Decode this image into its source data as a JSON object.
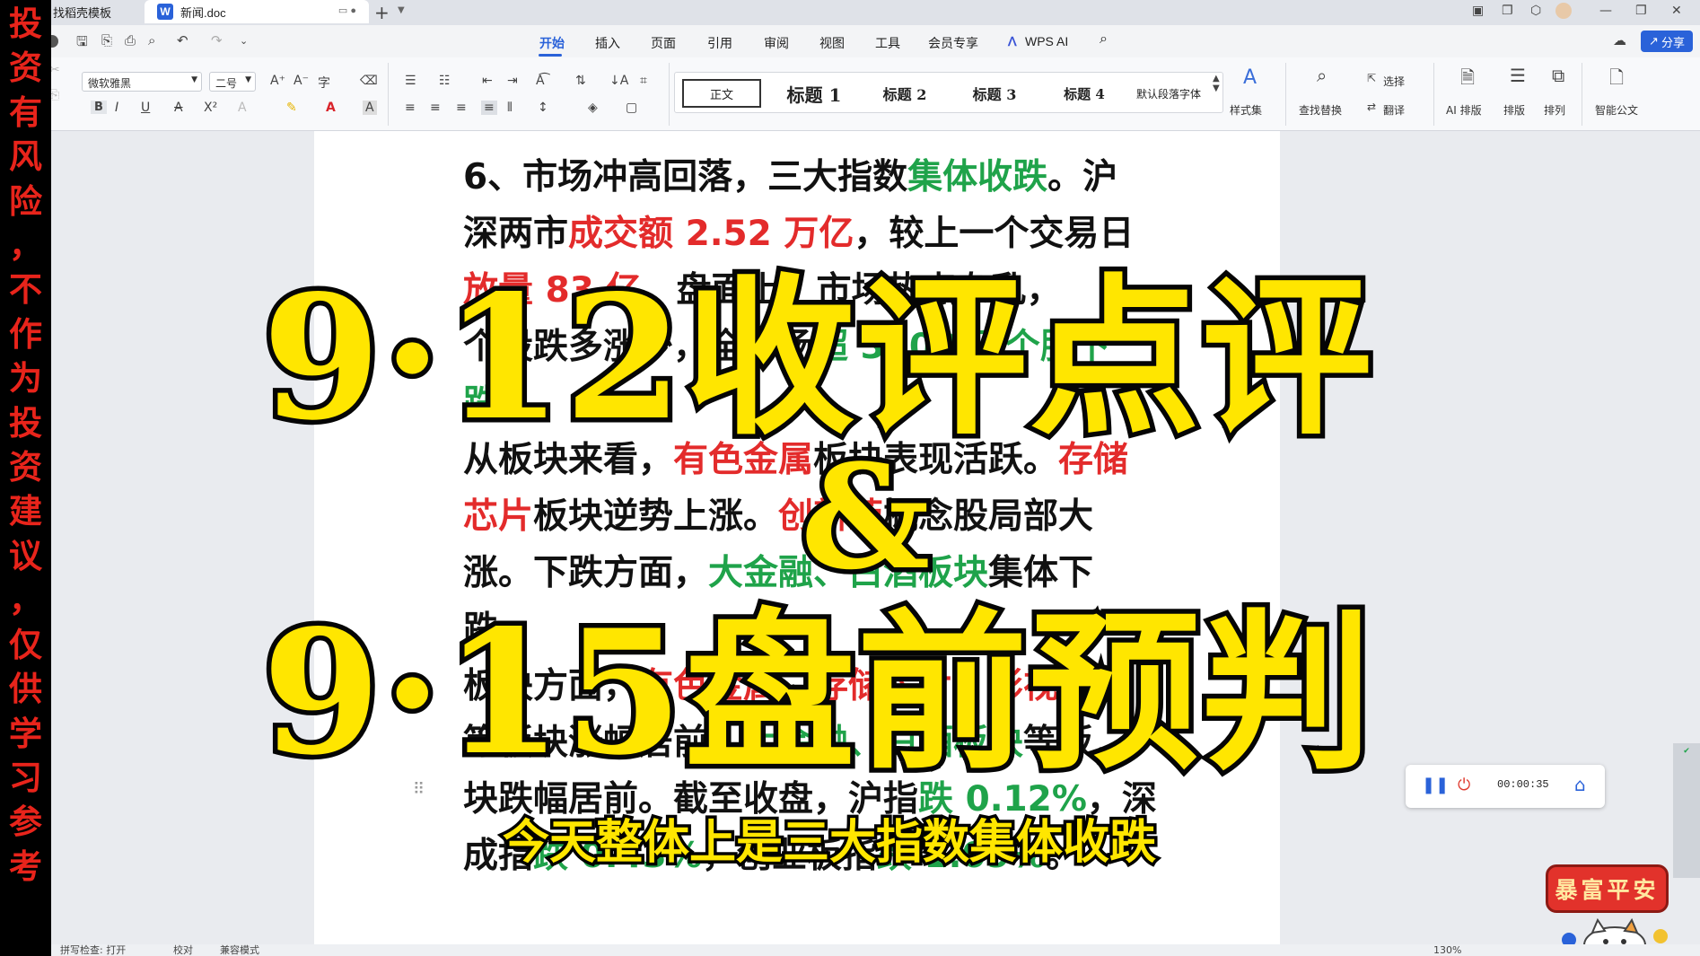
{
  "warning_text": "投资有风险，不作为投资建议，仅供学习参考",
  "titlebar": {
    "tab_template": "找稻壳模板",
    "tab_doc": "新闻.doc",
    "doc_icon_letter": "W"
  },
  "menu": {
    "items": [
      "开始",
      "插入",
      "页面",
      "引用",
      "审阅",
      "视图",
      "工具",
      "会员专享",
      "WPS AI"
    ],
    "share": "分享"
  },
  "ribbon": {
    "font_name": "微软雅黑",
    "font_size": "二号",
    "styles": [
      "正文",
      "标题 1",
      "标题 2",
      "标题 3",
      "标题 4",
      "默认段落字体"
    ],
    "style_set": "样式集",
    "find_replace": "查找替换",
    "select": "选择",
    "translate": "翻译",
    "ai_layout": "AI 排版",
    "layout": "排版",
    "arrange": "排列",
    "smart_doc": "智能公文"
  },
  "document": {
    "l1": "6、市场冲高回落，三大指数",
    "l1_green": "集体收跌",
    "l1_tail": "。沪",
    "l2": "深两市",
    "l2_red": "成交额 2.52 万亿",
    "l2_tail": "，较上一个交易日",
    "l3_red": "放量 83 亿",
    "l3": "，盘面上，市场热点杂乱，",
    "l4": "个股跌多涨少，全市场",
    "l4_green": "超 3300 只个股下跌",
    "l4_tail": "。",
    "l5": "从板块来看，",
    "l5_red": "有色金属",
    "l5_mid": "板块表现活跃。",
    "l5_red2": "存储",
    "l6_red": "芯片",
    "l6": "板块逆势上涨。",
    "l6_red2": "创新药",
    "l6_tail": "概念股局部大",
    "l7": "涨。下跌方面，",
    "l7_green": "大金融、白酒板块",
    "l7_tail": "集体下跌。",
    "l8": "板块方面，",
    "l8_red": "有色金属、存储芯片、影视院线",
    "l9": "等板块涨幅居前，",
    "l9_green": "大金融、白酒板块",
    "l9_tail": "等板",
    "l10": "块跌幅居前。截至收盘，沪指",
    "l10_green": "跌 0.12%",
    "l10_tail": "，深",
    "l11": "成指",
    "l11_green": "跌 0.43%",
    "l11_mid": "，创业板指",
    "l11_green2": "跌 1.09%",
    "l11_tail": "。"
  },
  "overlay": {
    "line1": "9·12收评点评",
    "amp": "&",
    "line2": "9·15盘前预判",
    "subtitle": "今天整体上是三大指数集体收跌"
  },
  "recorder": {
    "time": "00:00:35"
  },
  "stamp": {
    "text": "暴富平安"
  },
  "statusbar": {
    "spell": "拼写检查: 打开",
    "proof": "校对",
    "compat": "兼容模式",
    "zoom": "130%"
  },
  "colors": {
    "accent": "#2a62d9",
    "doc_red": "#e32b2b",
    "doc_green": "#1fa34a",
    "overlay_yellow": "#ffe600",
    "warning_red": "#e8241b"
  }
}
